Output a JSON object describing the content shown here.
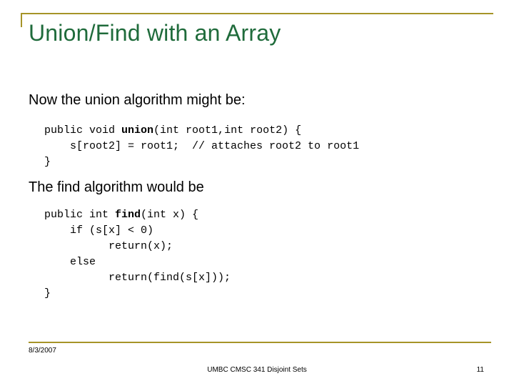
{
  "slide": {
    "title": "Union/Find with an Array",
    "intro_line": "Now the union algorithm might be:",
    "union_code": "public void union(int root1,int root2) {\n    s[root2] = root1;  // attaches root2 to root1\n}",
    "find_heading": "The find algorithm would be",
    "find_code": "public int find(int x) {\n    if (s[x] < 0)\n          return(x);\n    else\n          return(find(s[x]));\n}",
    "accent_color": "#a69428",
    "title_color": "#1f6b3b"
  },
  "footer": {
    "date": "8/3/2007",
    "center": "UMBC CMSC 341 Disjoint Sets",
    "page_number": "11"
  }
}
